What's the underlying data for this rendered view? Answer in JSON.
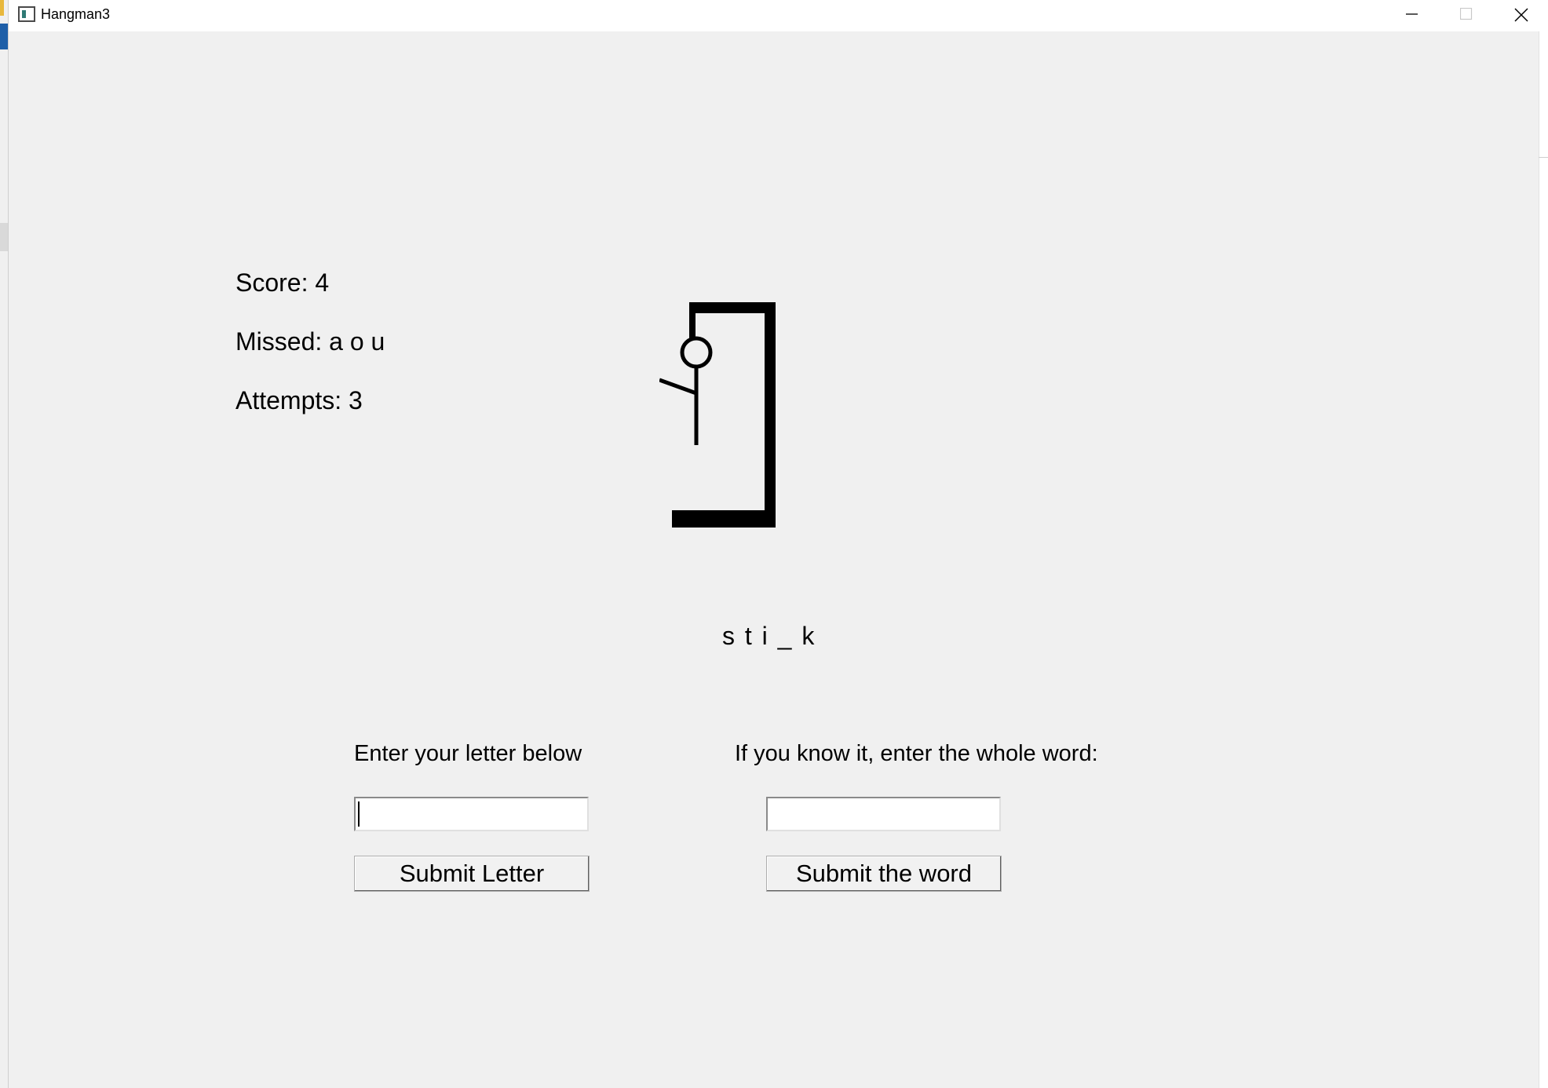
{
  "window": {
    "title": "Hangman3"
  },
  "stats": {
    "score": "Score: 4",
    "missed": "Missed: a o u",
    "attempts": "Attempts: 3"
  },
  "word": {
    "display": "s t i _ k"
  },
  "letter_entry": {
    "prompt": "Enter your letter below",
    "value": "",
    "button_label": "Submit Letter"
  },
  "word_entry": {
    "prompt": "If you know it, enter the whole word:",
    "value": "",
    "button_label": "Submit the word"
  },
  "hangman_figure": {
    "parts_shown": [
      "head",
      "body",
      "left-arm"
    ]
  },
  "colors": {
    "window_background": "#f0f0f0",
    "titlebar_background": "#ffffff",
    "drawing": "#000000"
  }
}
